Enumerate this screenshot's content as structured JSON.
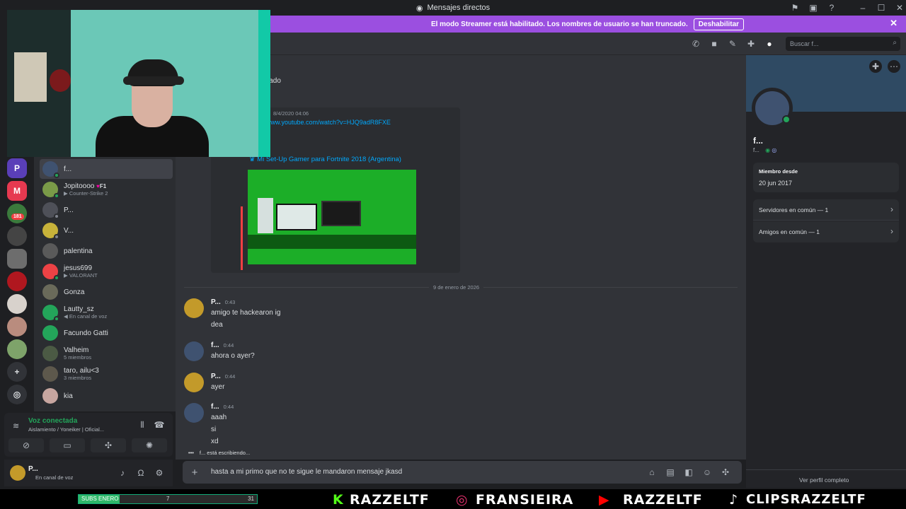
{
  "window": {
    "title": "Mensajes directos"
  },
  "banner": {
    "text": "El modo Streamer está habilitado. Los nombres de usuario se han truncado.",
    "button": "Deshabilitar"
  },
  "topbar": {
    "search_placeholder": "Buscar f..."
  },
  "servers": {
    "badge": "181"
  },
  "dms": [
    {
      "name": "f...",
      "sub": ""
    },
    {
      "name": "Jopitoooo",
      "tag": "F1",
      "sub": "Counter-Strike 2"
    },
    {
      "name": "P...",
      "sub": ""
    },
    {
      "name": "V...",
      "sub": ""
    },
    {
      "name": "palentina",
      "sub": ""
    },
    {
      "name": "jesus699",
      "sub": "VALORANT"
    },
    {
      "name": "Gonza",
      "sub": ""
    },
    {
      "name": "Lautty_sz",
      "sub": "En canal de voz"
    },
    {
      "name": "Facundo Gatti",
      "sub": ""
    },
    {
      "name": "Valheim",
      "sub": "5 miembros"
    },
    {
      "name": "taro, ailu<3",
      "sub": "3 miembros"
    },
    {
      "name": "kia",
      "sub": ""
    }
  ],
  "voice": {
    "status": "Voz conectada",
    "channel": "Aislamiento / Yoneiker | Oficial..."
  },
  "user": {
    "name": "P...",
    "status": "En canal de voz"
  },
  "chat": {
    "partial_text": "lado",
    "embed": {
      "timestamp": "8/4/2020 04:06",
      "link": "www.youtube.com/watch?v=HJQ9adR8FXE",
      "title": "Mi Set-Up Gamer para Fortnite 2018 (Argentina)"
    },
    "divider": "9 de enero de 2026",
    "messages": [
      {
        "author": "P...",
        "time": "0:43",
        "lines": [
          "amigo te hackearon ig",
          "dea"
        ]
      },
      {
        "author": "f...",
        "time": "0:44",
        "lines": [
          "ahora o ayer?"
        ]
      },
      {
        "author": "P...",
        "time": "0:44",
        "lines": [
          "ayer"
        ]
      },
      {
        "author": "f...",
        "time": "0:44",
        "lines": [
          "aaah",
          "si",
          "xd"
        ]
      }
    ],
    "typing": "f... está escribiendo..."
  },
  "composer": {
    "value": "hasta a mi primo que no te sigue le mandaron mensaje jkasd"
  },
  "profile": {
    "name": "f...",
    "tag": "f...",
    "member_since_label": "Miembro desde",
    "member_since": "20 jun 2017",
    "mutual_servers": "Servidores en común — 1",
    "mutual_friends": "Amigos en común — 1",
    "full_profile": "Ver perfil completo"
  },
  "overlay": {
    "subs_label": "SUBS ENERO",
    "subs_current": "7",
    "subs_goal": "31",
    "subs_progress": 0.23,
    "kick": "RAZZELTF",
    "instagram": "FRANSIEIRA",
    "youtube": "RAZZELTF",
    "tiktok": "CLIPSRAZZELTF"
  },
  "colors": {
    "accent": "#5865f2",
    "banner": "#9b4fe0",
    "online": "#23a55a",
    "link": "#00a8fc"
  }
}
